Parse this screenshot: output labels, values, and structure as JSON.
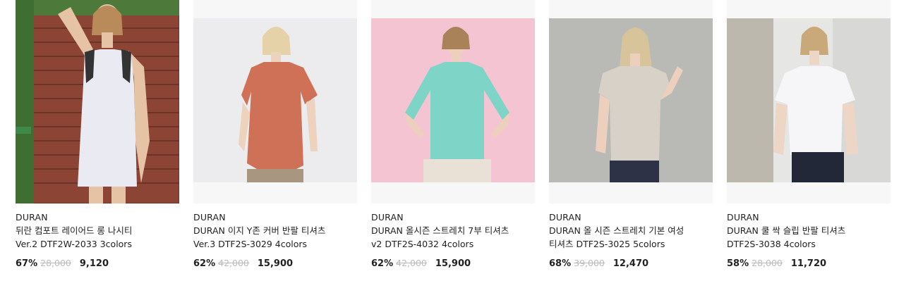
{
  "products": [
    {
      "brand": "DURAN",
      "name": "뒤란 컴포트 레이어드 롱 나시티 Ver.2 DTF2W-2033 3colors",
      "rate": "67%",
      "orig": "28,000",
      "sale": "9,120",
      "image": {
        "desc": "model in white layered long tank dress",
        "bg": "#8a4a3a",
        "garment": "#e9eaf2"
      }
    },
    {
      "brand": "DURAN",
      "name": "DURAN 이지 Y존 커버 반팔 티셔츠 Ver.3 DTF2S-3029 4colors",
      "rate": "62%",
      "orig": "42,000",
      "sale": "15,900",
      "image": {
        "desc": "model in orange short sleeve tee",
        "bg": "#ececee",
        "garment": "#cf7156"
      }
    },
    {
      "brand": "DURAN",
      "name": "DURAN 올시즌 스트레치 7부 티셔츠 v2 DTF2S-4032 4colors",
      "rate": "62%",
      "orig": "42,000",
      "sale": "15,900",
      "image": {
        "desc": "model in mint three-quarter sleeve tee",
        "bg": "#f4c4d3",
        "garment": "#7ed4c6"
      }
    },
    {
      "brand": "DURAN",
      "name": "DURAN 올 시즌 스트레치 기본 여성 티셔츠 DTF2S-3025 5colors",
      "rate": "68%",
      "orig": "39,000",
      "sale": "12,470",
      "image": {
        "desc": "model in beige short sleeve tee",
        "bg": "#b9bab6",
        "garment": "#d8d1c8"
      }
    },
    {
      "brand": "DURAN",
      "name": "DURAN 쿨 싹 슬립 반팔 티셔츠 DTF2S-3038 4colors",
      "rate": "58%",
      "orig": "28,000",
      "sale": "11,720",
      "image": {
        "desc": "model in white short sleeve tee",
        "bg": "#e6e6e4",
        "garment": "#f6f6f8"
      }
    }
  ]
}
